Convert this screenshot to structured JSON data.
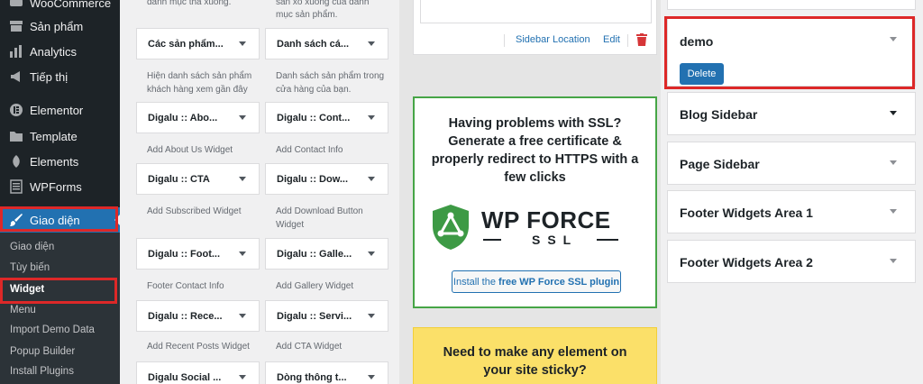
{
  "sidebar": {
    "menu": [
      {
        "label": "WooCommerce",
        "icon": "woocommerce-icon"
      },
      {
        "label": "Sản phẩm",
        "icon": "archive-icon"
      },
      {
        "label": "Analytics",
        "icon": "bar-chart-icon"
      },
      {
        "label": "Tiếp thị",
        "icon": "megaphone-icon"
      },
      {
        "label": "Elementor",
        "icon": "elementor-icon"
      },
      {
        "label": "Template",
        "icon": "folder-icon"
      },
      {
        "label": "Elements",
        "icon": "leaf-icon"
      },
      {
        "label": "WPForms",
        "icon": "form-icon"
      },
      {
        "label": "Giao diện",
        "icon": "paintbrush-icon"
      }
    ],
    "submenu": [
      "Giao diện",
      "Tùy biến",
      "Widget",
      "Menu",
      "Import Demo Data",
      "Popup Builder",
      "Install Plugins"
    ]
  },
  "available_widgets": {
    "top_descriptions": [
      "danh mục thả xuống.",
      "sản xổ xuống của danh",
      "mục sản phẩm."
    ],
    "cards": [
      {
        "title": "Các sản phẩm...",
        "desc": "Hiện danh sách sản phẩm khách hàng xem gần đây"
      },
      {
        "title": "Danh sách cá...",
        "desc": "Danh sách sản phẩm trong cửa hàng của bạn."
      },
      {
        "title": "Digalu :: Abo...",
        "desc": "Add About Us Widget"
      },
      {
        "title": "Digalu :: Cont...",
        "desc": "Add Contact Info"
      },
      {
        "title": "Digalu :: CTA",
        "desc": "Add Subscribed Widget"
      },
      {
        "title": "Digalu :: Dow...",
        "desc": "Add Download Button Widget"
      },
      {
        "title": "Digalu :: Foot...",
        "desc": "Footer Contact Info"
      },
      {
        "title": "Digalu :: Galle...",
        "desc": "Add Gallery Widget"
      },
      {
        "title": "Digalu :: Rece...",
        "desc": "Add Recent Posts Widget"
      },
      {
        "title": "Digalu :: Servi...",
        "desc": "Add CTA Widget"
      },
      {
        "title": "Digalu Social ...",
        "desc": ""
      },
      {
        "title": "Dòng thông t...",
        "desc": ""
      }
    ]
  },
  "middle": {
    "toolbar": {
      "location": "Sidebar Location",
      "edit": "Edit"
    },
    "ssl": {
      "title_lines": [
        "Having problems with SSL?",
        "Generate a free certificate &",
        "properly redirect to HTTPS with a",
        "few clicks"
      ],
      "logo_word": "WP FORCE",
      "logo_sub": "SSL",
      "button_prefix": "Install the",
      "button_strong": "free WP Force SSL plugin"
    },
    "sticky": {
      "title_lines": [
        "Need to make any element on",
        "your site sticky?"
      ]
    }
  },
  "right_sidebars": {
    "demo": {
      "name": "demo",
      "delete_label": "Delete"
    },
    "panels": [
      "Blog Sidebar",
      "Page Sidebar",
      "Footer Widgets Area 1",
      "Footer Widgets Area 2"
    ]
  },
  "colors": {
    "admin_bar": "#1d2327",
    "accent": "#2271b1",
    "highlight_red": "#dd2828",
    "ssl_green": "#46a546",
    "sticky_yellow": "#fbe069"
  }
}
